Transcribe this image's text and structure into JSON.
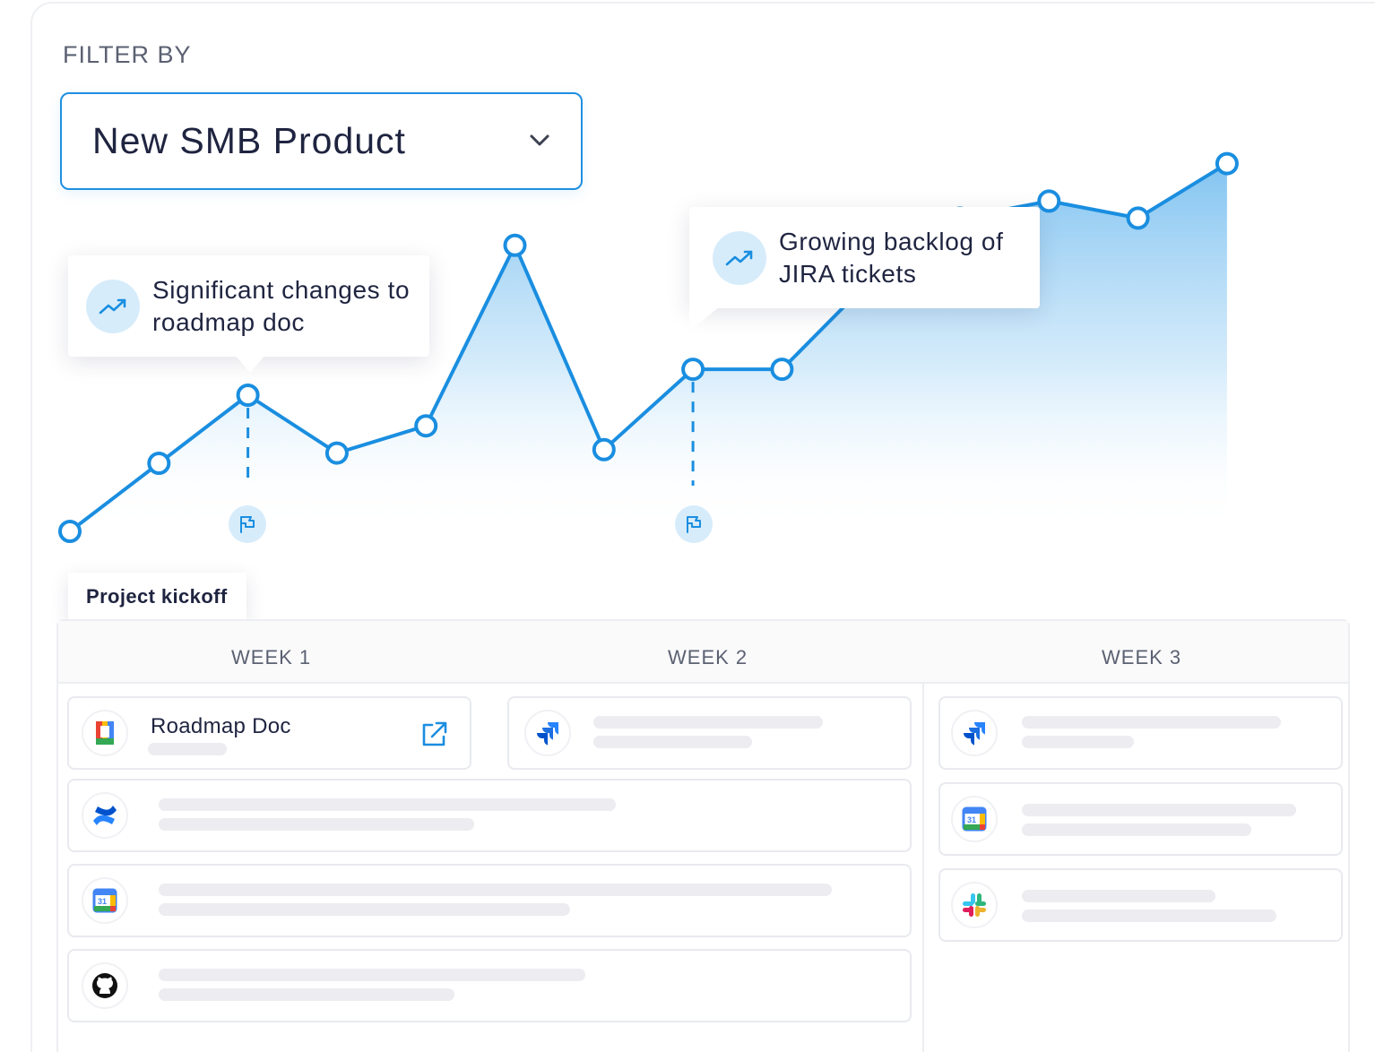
{
  "filter": {
    "label": "FILTER BY",
    "selected": "New SMB Product"
  },
  "chart_data": {
    "type": "area",
    "values": [
      0,
      1,
      2,
      1.15,
      1.55,
      4.2,
      1.2,
      2.38,
      2.38,
      3.7,
      4.6,
      4.85,
      4.6,
      5.4
    ],
    "annotations": [
      {
        "point_index": 2,
        "text": "Significant changes to roadmap doc",
        "icon": "trending-up-icon"
      },
      {
        "point_index": 7,
        "text": "Growing backlog of JIRA tickets",
        "icon": "trending-up-icon"
      }
    ],
    "flag_markers": [
      2,
      7
    ],
    "start_label": "Project kickoff"
  },
  "colors": {
    "accent": "#1a8ee0",
    "accent_soft": "#d7ecfb",
    "text": "#1f2440",
    "muted": "#5b6172"
  },
  "timeline": {
    "weeks": [
      "WEEK 1",
      "WEEK 2",
      "WEEK 3"
    ],
    "items": [
      {
        "app": "google-docs-icon",
        "title": "Roadmap Doc",
        "action": "external-link-icon"
      },
      {
        "app": "jira-icon"
      },
      {
        "app": "confluence-icon"
      },
      {
        "app": "google-calendar-icon"
      },
      {
        "app": "github-icon"
      },
      {
        "app": "jira-icon"
      },
      {
        "app": "google-calendar-icon"
      },
      {
        "app": "slack-icon"
      }
    ],
    "calendar_day": "31"
  }
}
